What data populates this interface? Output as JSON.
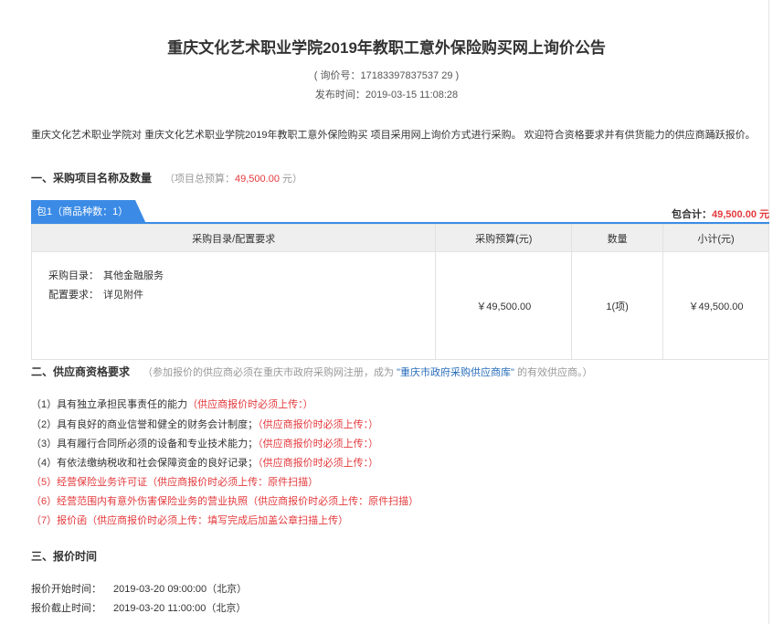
{
  "title": "重庆文化艺术职业学院2019年教职工意外保险购买网上询价公告",
  "inquiry_no": "( 询价号：17183397837537 29 )",
  "publish_time": "发布时间：2019-03-15 11:08:28",
  "intro": "重庆文化艺术职业学院对 重庆文化艺术职业学院2019年教职工意外保险购买 项目采用网上询价方式进行采购。 欢迎符合资格要求并有供货能力的供应商踊跃报价。",
  "section1": {
    "heading": "一、采购项目名称及数量",
    "note_prefix": "（项目总预算：",
    "budget": "49,500.00",
    "note_suffix": " 元）"
  },
  "package": {
    "tab": "包1（商品种数：1）",
    "total_label": "包合计：",
    "total_value": "49,500.00",
    "total_unit": " 元"
  },
  "table": {
    "headers": [
      "采购目录/配置要求",
      "采购预算(元)",
      "数量",
      "小计(元)"
    ],
    "rows": [
      {
        "catalog_label": "采购目录：",
        "catalog_value": "其他金融服务",
        "config_label": "配置要求：",
        "config_value": "详见附件",
        "budget": "￥49,500.00",
        "qty": "1(项)",
        "subtotal": "￥49,500.00"
      }
    ]
  },
  "section2": {
    "heading": "二、供应商资格要求",
    "note_a": "（参加报价的供应商必须在重庆市政府采购网注册，成为",
    "note_link": "\"重庆市政府采购供应商库\"",
    "note_b": "的有效供应商。）"
  },
  "requirements": [
    {
      "text": "（1）具有独立承担民事责任的能力",
      "upload": "（供应商报价时必须上传：）",
      "all_red": false
    },
    {
      "text": "（2）具有良好的商业信誉和健全的财务会计制度；",
      "upload": "（供应商报价时必须上传：）",
      "all_red": false
    },
    {
      "text": "（3）具有履行合同所必须的设备和专业技术能力；",
      "upload": "（供应商报价时必须上传：）",
      "all_red": false
    },
    {
      "text": "（4）有依法缴纳税收和社会保障资金的良好记录；",
      "upload": "（供应商报价时必须上传：）",
      "all_red": false
    },
    {
      "text": "（5）经营保险业务许可证",
      "upload": "（供应商报价时必须上传：原件扫描）",
      "all_red": true
    },
    {
      "text": "（6）经营范围内有意外伤害保险业务的营业执照",
      "upload": "（供应商报价时必须上传：原件扫描）",
      "all_red": true
    },
    {
      "text": "（7）报价函",
      "upload": "（供应商报价时必须上传：填写完成后加盖公章扫描上传）",
      "all_red": true
    }
  ],
  "section3": {
    "heading": "三、报价时间",
    "start_label": "报价开始时间：",
    "start_value": "2019-03-20 09:00:00（北京）",
    "end_label": "报价截止时间：",
    "end_value": "2019-03-20 11:00:00（北京）"
  },
  "colors": {
    "accent": "#3b8be6",
    "red": "#e4393c",
    "link": "#2a6ebb"
  }
}
